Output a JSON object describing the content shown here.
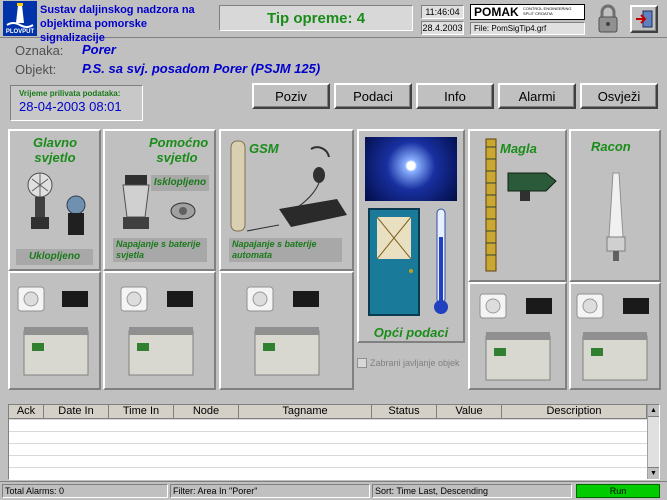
{
  "header": {
    "system_title_line1": "Sustav daljinskog nadzora na",
    "system_title_line2": "objektima pomorske signalizacije",
    "logo_text": "PLOVPUT",
    "equipment_type": "Tip opreme: 4",
    "time": "11:46:04",
    "date": "28.4.2003",
    "company_name": "POMAK",
    "company_sub1": "CONTROL ENGINEERING",
    "company_sub2": "SPLIT CROATIA",
    "file_label": "File:  PomSigTip4.grf"
  },
  "object_info": {
    "oznaka_label": "Oznaka:",
    "oznaka_value": "Porer",
    "objekt_label": "Objekt:",
    "objekt_value": "P.S. sa svj. posadom Porer (PSJM 125)"
  },
  "data_time": {
    "label": "Vrijeme prilivata podataka:",
    "value": "28-04-2003 08:01"
  },
  "toolbar": {
    "poziv": "Poziv",
    "podaci": "Podaci",
    "info": "Info",
    "alarmi": "Alarmi",
    "osvjezi": "Osvježi"
  },
  "panels": {
    "glavno_title": "Glavno svjetlo",
    "glavno_status": "Uklopljeno",
    "pomocno_title": "Pomoćno svjetlo",
    "pomocno_status": "Isklopljeno",
    "pomocno_power": "Napajanje s baterije svjetla",
    "gsm_title": "GSM",
    "gsm_power": "Napajanje s baterije automata",
    "opci_title": "Opći podaci",
    "zabrani_label": "Zabrani javljanje objek",
    "magla_title": "Magla",
    "racon_title": "Racon"
  },
  "alarm_table": {
    "columns": [
      "Ack",
      "Date In",
      "Time In",
      "Node",
      "Tagname",
      "Status",
      "Value",
      "Description"
    ]
  },
  "status_bar": {
    "total_alarms": "Total Alarms: 0",
    "filter": "Filter: Area In \"Porer\"",
    "sort": "Sort: Time Last, Descending",
    "run": "Run"
  },
  "colors": {
    "title_blue": "#0000cc",
    "title_bg": "#0033cc",
    "green_text": "#1a8c1a",
    "run_green": "#00cc00",
    "equip_bg": "#e8e8e8"
  }
}
